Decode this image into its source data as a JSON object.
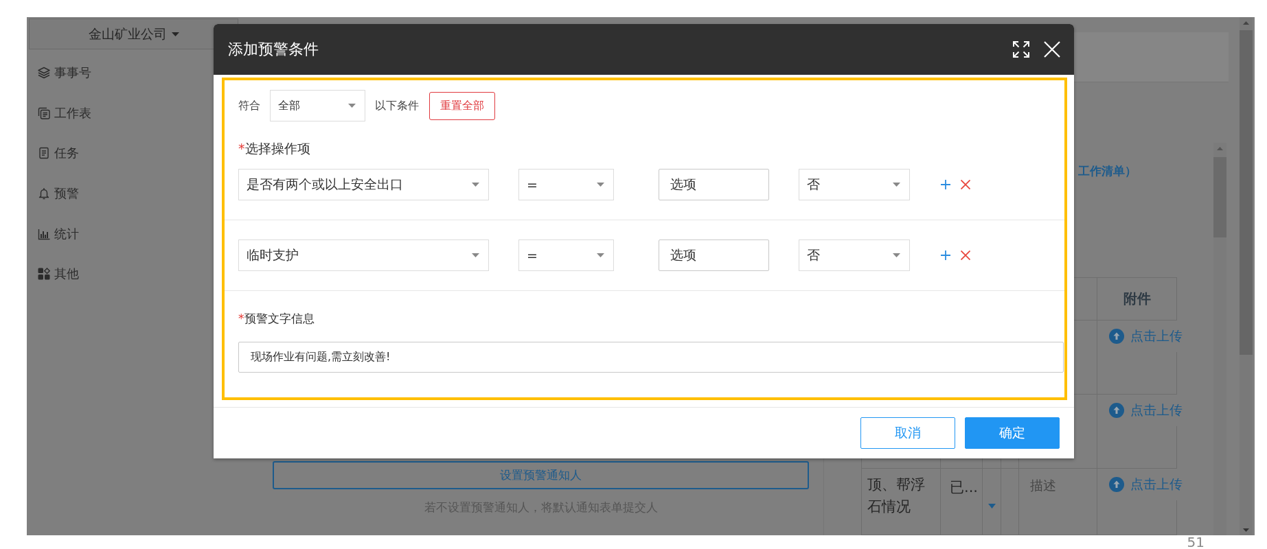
{
  "sidebar": {
    "company": "金山矿业公司",
    "items": [
      {
        "kind": "layers",
        "label": "事事号"
      },
      {
        "kind": "sheet",
        "label": "工作表"
      },
      {
        "kind": "task",
        "label": "任务"
      },
      {
        "kind": "bell",
        "label": "预警"
      },
      {
        "kind": "chart",
        "label": "统计"
      },
      {
        "kind": "apps",
        "label": "其他"
      }
    ]
  },
  "page": {
    "link_text": "工作清单）",
    "table": {
      "header": "附件",
      "rows": [
        {
          "upload": "点击上传"
        },
        {
          "upload": "点击上传"
        },
        {
          "item": "顶、帮浮石情况",
          "status": "已...",
          "placeholder": "描述",
          "upload": "点击上传"
        }
      ]
    },
    "notify_button": "设置预警通知人",
    "notify_hint": "若不设置预警通知人，将默认通知表单提交人"
  },
  "dialog": {
    "title": "添加预警条件",
    "match": {
      "label": "符合",
      "value": "全部",
      "suffix": "以下条件",
      "reset": "重置全部"
    },
    "condition_label": {
      "mark": "*",
      "text": "选择操作项"
    },
    "conditions": [
      {
        "field": "是否有两个或以上安全出口",
        "operator": "=",
        "type": "选项",
        "value": "否"
      },
      {
        "field": "临时支护",
        "operator": "=",
        "type": "选项",
        "value": "否"
      }
    ],
    "message_label": {
      "mark": "*",
      "text": "预警文字信息"
    },
    "message": "现场作业有问题,需立刻改善!",
    "buttons": [
      {
        "kind": "secondary",
        "label": "取消"
      },
      {
        "kind": "primary",
        "label": "确定"
      }
    ]
  },
  "page_number": "51"
}
